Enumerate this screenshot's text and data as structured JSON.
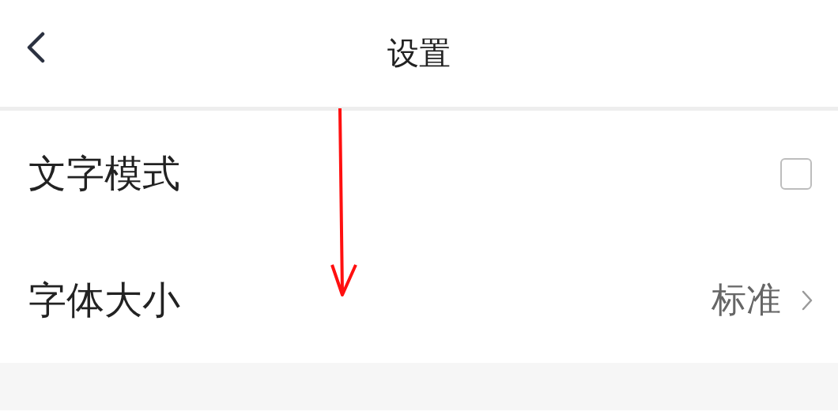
{
  "header": {
    "title": "设置"
  },
  "settings": [
    {
      "kind": "checkbox",
      "label": "文字模式",
      "checked": false
    },
    {
      "kind": "value",
      "label": "字体大小",
      "value": "标准"
    }
  ]
}
